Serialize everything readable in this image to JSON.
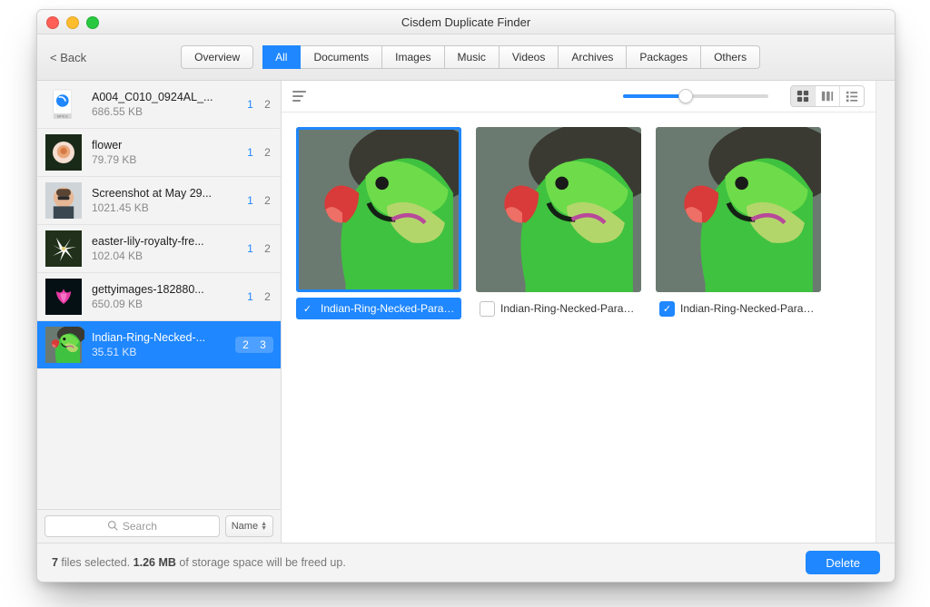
{
  "window": {
    "title": "Cisdem Duplicate Finder"
  },
  "toolbar": {
    "back": "< Back",
    "overview": "Overview",
    "tabs": {
      "all": "All",
      "documents": "Documents",
      "images": "Images",
      "music": "Music",
      "videos": "Videos",
      "archives": "Archives",
      "packages": "Packages",
      "others": "Others"
    },
    "active_tab": "all"
  },
  "sidebar": {
    "search_placeholder": "Search",
    "sort_label": "Name",
    "items": [
      {
        "name": "A004_C010_0924AL_...",
        "size": "686.55 KB",
        "selected_count": "1",
        "total_count": "2",
        "thumb": "movie",
        "active": false
      },
      {
        "name": "flower",
        "size": "79.79 KB",
        "selected_count": "1",
        "total_count": "2",
        "thumb": "rose",
        "active": false
      },
      {
        "name": "Screenshot at May 29...",
        "size": "1021.45 KB",
        "selected_count": "1",
        "total_count": "2",
        "thumb": "face",
        "active": false
      },
      {
        "name": "easter-lily-royalty-fre...",
        "size": "102.04 KB",
        "selected_count": "1",
        "total_count": "2",
        "thumb": "lily",
        "active": false
      },
      {
        "name": "gettyimages-182880...",
        "size": "650.09 KB",
        "selected_count": "1",
        "total_count": "2",
        "thumb": "lotus",
        "active": false
      },
      {
        "name": "Indian-Ring-Necked-...",
        "size": "35.51 KB",
        "selected_count": "2",
        "total_count": "3",
        "thumb": "parrot",
        "active": true
      }
    ]
  },
  "main": {
    "items": [
      {
        "caption": "Indian-Ring-Necked-Parak...",
        "checked": true,
        "selected": true
      },
      {
        "caption": "Indian-Ring-Necked-Parake...",
        "checked": false,
        "selected": false
      },
      {
        "caption": "Indian-Ring-Necked-Parake...",
        "checked": true,
        "selected": false
      }
    ],
    "slider_value": 43,
    "view_mode": "grid"
  },
  "footer": {
    "selected_count": "7",
    "mid1": " files selected. ",
    "freed": "1.26 MB",
    "mid2": " of storage space will be freed up.",
    "delete": "Delete"
  },
  "colors": {
    "accent": "#1f87ff"
  }
}
